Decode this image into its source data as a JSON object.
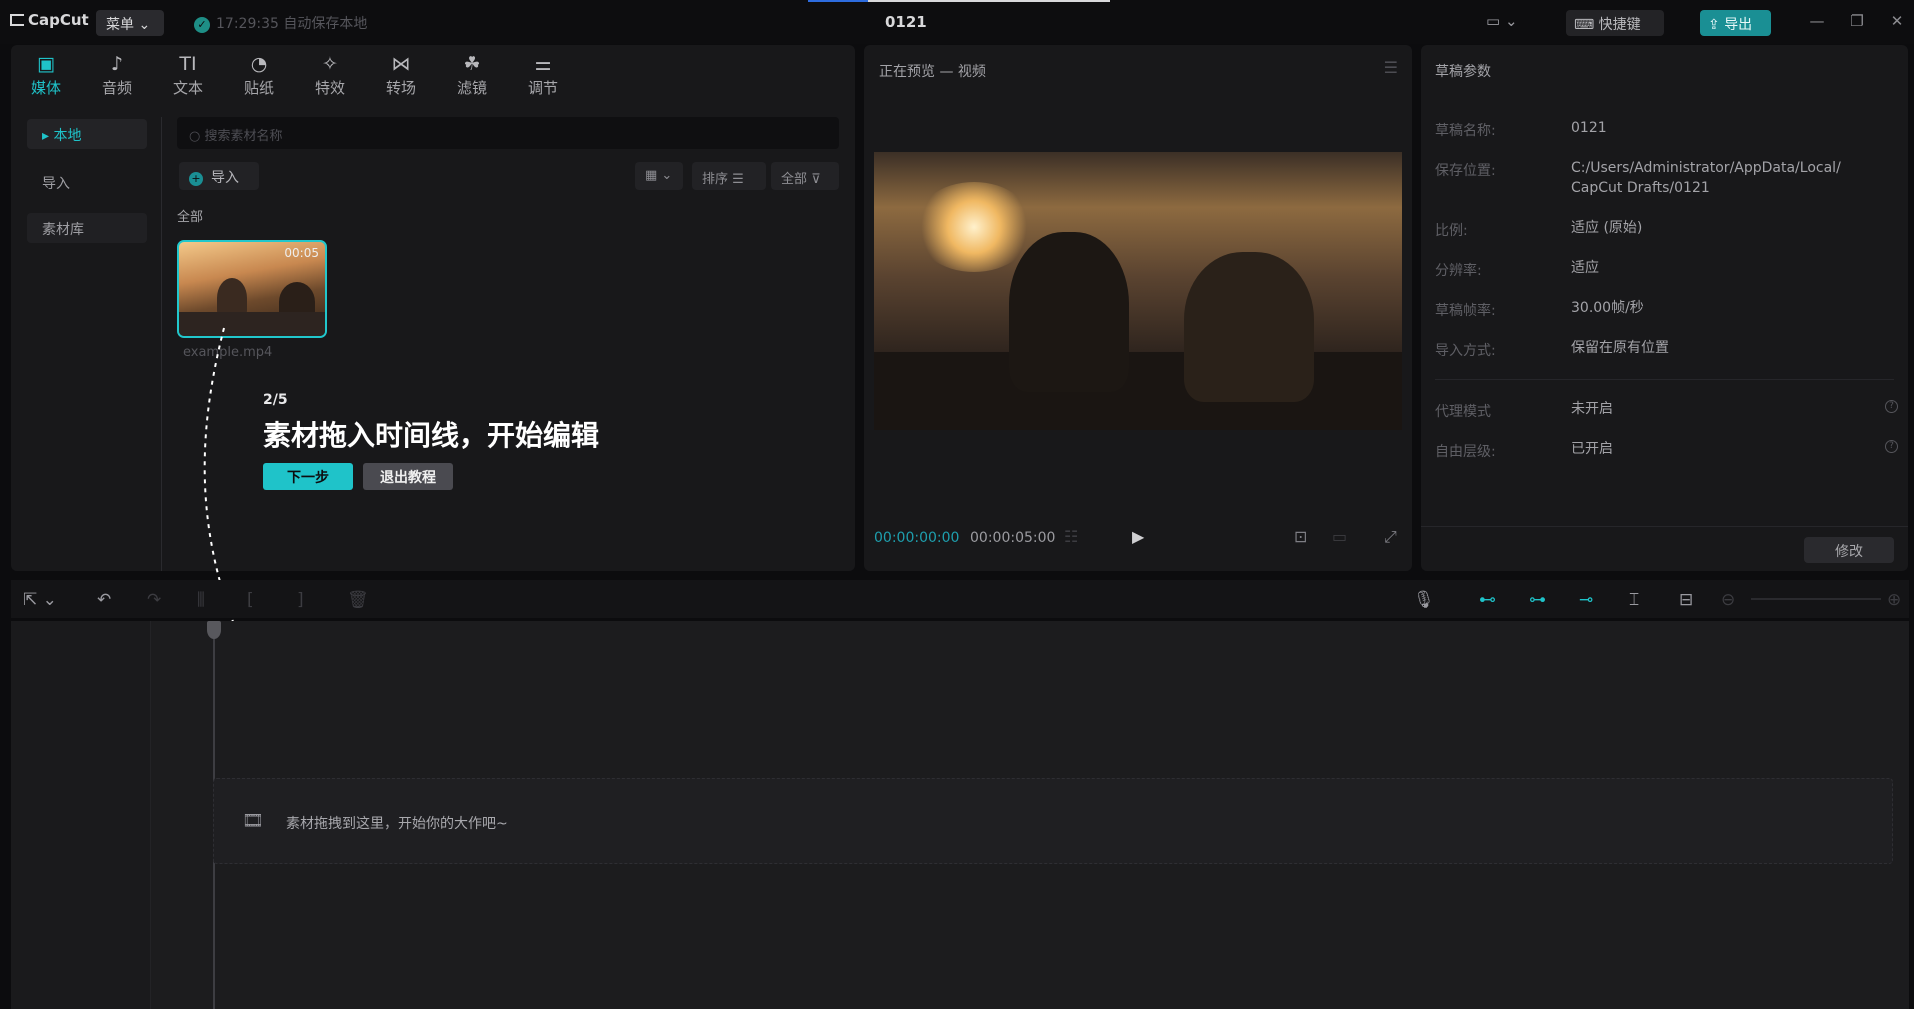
{
  "app": {
    "logo_text": "CapCut",
    "menu_label": "菜单",
    "save_status": "17:29:35 自动保存本地",
    "project_title": "0121",
    "shortcut_label": "快捷键",
    "export_label": "导出"
  },
  "media": {
    "tabs": [
      {
        "label": "媒体",
        "icon": "media-icon"
      },
      {
        "label": "音频",
        "icon": "audio-icon"
      },
      {
        "label": "文本",
        "icon": "text-icon"
      },
      {
        "label": "贴纸",
        "icon": "sticker-icon"
      },
      {
        "label": "特效",
        "icon": "effects-icon"
      },
      {
        "label": "转场",
        "icon": "transition-icon"
      },
      {
        "label": "滤镜",
        "icon": "filter-icon"
      },
      {
        "label": "调节",
        "icon": "adjust-icon"
      }
    ],
    "side": [
      "本地",
      "导入",
      "素材库"
    ],
    "search_placeholder": "搜索素材名称",
    "import_label": "导入",
    "sort_label": "排序",
    "filter_label": "全部",
    "section_label": "全部",
    "clip": {
      "name": "example.mp4",
      "duration": "00:05"
    }
  },
  "tutorial": {
    "step": "2/5",
    "title": "素材拖入时间线，开始编辑",
    "next_label": "下一步",
    "exit_label": "退出教程"
  },
  "preview": {
    "title": "正在预览 — 视频",
    "current_time": "00:00:00:00",
    "total_time": "00:00:05:00"
  },
  "params": {
    "title": "草稿参数",
    "rows": [
      {
        "key": "草稿名称:",
        "value": "0121"
      },
      {
        "key": "保存位置:",
        "value": "C:/Users/Administrator/AppData/Local/ CapCut Drafts/0121"
      },
      {
        "key": "比例:",
        "value": "适应 (原始)"
      },
      {
        "key": "分辨率:",
        "value": "适应"
      },
      {
        "key": "草稿帧率:",
        "value": "30.00帧/秒"
      },
      {
        "key": "导入方式:",
        "value": "保留在原有位置"
      }
    ],
    "rows2": [
      {
        "key": "代理模式",
        "value": "未开启"
      },
      {
        "key": "自由层级:",
        "value": "已开启"
      }
    ],
    "modify_label": "修改"
  },
  "timeline": {
    "drop_hint": "素材拖拽到这里，开始你的大作吧~"
  },
  "colors": {
    "accent": "#1fc3c9",
    "export": "#1a8f94",
    "background": "#0c0c0e",
    "panel": "#18181a"
  }
}
